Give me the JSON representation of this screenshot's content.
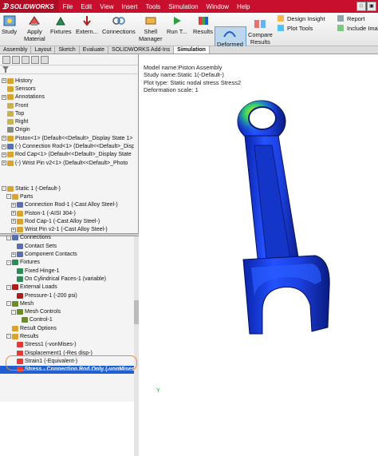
{
  "app": {
    "logo": "SOLIDWORKS",
    "brand_color": "#c8102e"
  },
  "menu": [
    "File",
    "Edit",
    "View",
    "Insert",
    "Tools",
    "Simulation",
    "Window",
    "Help"
  ],
  "ribbon": {
    "study": "Study",
    "apply_material": "Apply\nMaterial",
    "fixtures": "Fixtures",
    "external": "Extern...",
    "connections": "Connections",
    "shell_manager": "Shell\nManager",
    "run": "Run T...",
    "results": "Results",
    "deformed_result": "Deformed\nResult",
    "compare_results": "Compare\nResults",
    "design_insight": "Design Insight",
    "plot_tools": "Plot Tools",
    "report": "Report",
    "include_image": "Include Ima"
  },
  "tabs": [
    "Assembly",
    "Layout",
    "Sketch",
    "Evaluate",
    "SOLIDWORKS Add-Ins",
    "Simulation"
  ],
  "active_tab": "Simulation",
  "feature_tree": [
    {
      "label": "History",
      "indent": 0,
      "expander": "+"
    },
    {
      "label": "Sensors",
      "indent": 0,
      "expander": ""
    },
    {
      "label": "Annotations",
      "indent": 0,
      "expander": "+"
    },
    {
      "label": "Front",
      "indent": 0,
      "expander": ""
    },
    {
      "label": "Top",
      "indent": 0,
      "expander": ""
    },
    {
      "label": "Right",
      "indent": 0,
      "expander": ""
    },
    {
      "label": "Origin",
      "indent": 0,
      "expander": ""
    },
    {
      "label": "Piston<1> (Default<<Default>_Display State 1>",
      "indent": 0,
      "expander": "+"
    },
    {
      "label": "(-) Connection Rod<1> (Default<<Default>_Displ",
      "indent": 0,
      "expander": "+"
    },
    {
      "label": "Rod Cap<1> (Default<<Default>_Display State",
      "indent": 0,
      "expander": "+"
    },
    {
      "label": "(-) Wrist Pin v2<1> (Default<<Default>_Photo",
      "indent": 0,
      "expander": "+"
    }
  ],
  "study_tree": [
    {
      "label": "Static 1 (-Default-)",
      "indent": 0,
      "expander": "-"
    },
    {
      "label": "Parts",
      "indent": 1,
      "expander": "-"
    },
    {
      "label": "Connection Rod-1 (-Cast Alloy Steel-)",
      "indent": 2,
      "expander": "+"
    },
    {
      "label": "Piston-1 (-AISI 304-)",
      "indent": 2,
      "expander": "+"
    },
    {
      "label": "Rod Cap-1 (-Cast Alloy Steel-)",
      "indent": 2,
      "expander": "+"
    },
    {
      "label": "Wrist Pin v2-1 (-Cast Alloy Steel-)",
      "indent": 2,
      "expander": "+"
    },
    {
      "label": "Connections",
      "indent": 1,
      "expander": "-"
    },
    {
      "label": "Contact Sets",
      "indent": 2,
      "expander": ""
    },
    {
      "label": "Component Contacts",
      "indent": 2,
      "expander": "+"
    },
    {
      "label": "Fixtures",
      "indent": 1,
      "expander": "-"
    },
    {
      "label": "Fixed Hinge-1",
      "indent": 2,
      "expander": ""
    },
    {
      "label": "On Cylindrical Faces-1 (variable)",
      "indent": 2,
      "expander": ""
    },
    {
      "label": "External Loads",
      "indent": 1,
      "expander": "-"
    },
    {
      "label": "Pressure-1 (-200 psi)",
      "indent": 2,
      "expander": ""
    },
    {
      "label": "Mesh",
      "indent": 1,
      "expander": "-"
    },
    {
      "label": "Mesh Controls",
      "indent": 2,
      "expander": "-"
    },
    {
      "label": "Control-1",
      "indent": 3,
      "expander": ""
    },
    {
      "label": "Result Options",
      "indent": 1,
      "expander": ""
    },
    {
      "label": "Results",
      "indent": 1,
      "expander": "-"
    },
    {
      "label": "Stress1 (-vonMises-)",
      "indent": 2,
      "expander": ""
    },
    {
      "label": "Displacement1 (-Res disp-)",
      "indent": 2,
      "expander": ""
    },
    {
      "label": "Strain1 (-Equivalent-)",
      "indent": 2,
      "expander": ""
    },
    {
      "label": "Stress - Connection Rod Only (-vonMises-)",
      "indent": 2,
      "expander": "",
      "selected": true
    }
  ],
  "plot_info": {
    "model_name": "Model name:Piston Assembly",
    "study_name": "Study name:Static 1(-Default-)",
    "plot_type": "Plot type: Static nodal stress Stress2",
    "deformation": "Deformation scale: 1"
  },
  "triad_label": "Y",
  "colors": {
    "selection": "#1f5fd1",
    "highlight_oval": "#f08a2b",
    "stress_low": "#1a2fd0",
    "stress_high": "#ffe000"
  }
}
